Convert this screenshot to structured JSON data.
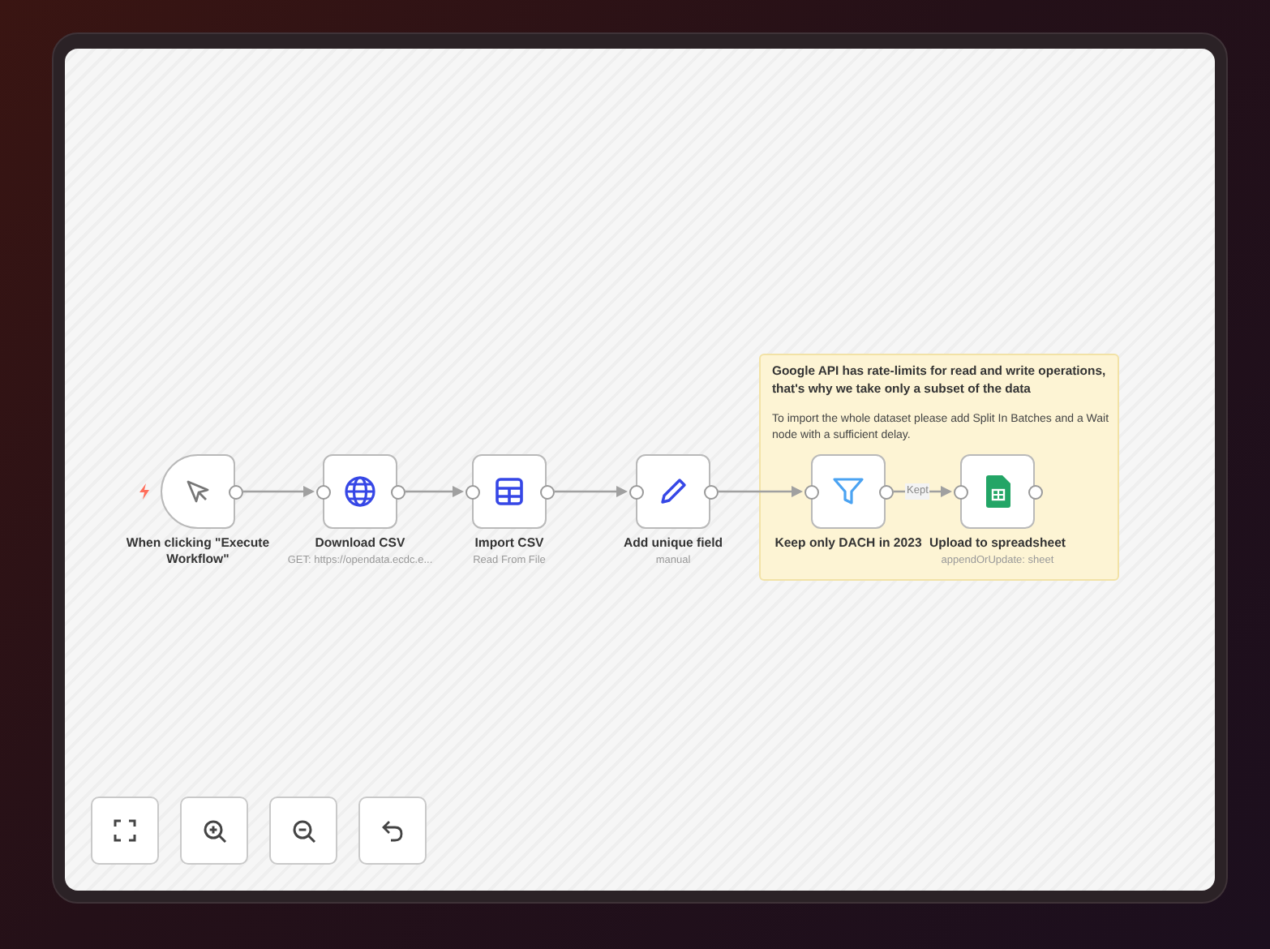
{
  "nodes": [
    {
      "kind": "trigger",
      "name": "When clicking \"Execute Workflow\""
    },
    {
      "kind": "http",
      "name": "Download CSV",
      "subtitle": "GET: https://opendata.ecdc.e..."
    },
    {
      "kind": "table",
      "name": "Import CSV",
      "subtitle": "Read From File"
    },
    {
      "kind": "edit",
      "name": "Add unique field",
      "subtitle": "manual"
    },
    {
      "kind": "filter",
      "name": "Keep only DACH in 2023",
      "output_label": "Kept"
    },
    {
      "kind": "sheets",
      "name": "Upload to spreadsheet",
      "subtitle": "appendOrUpdate: sheet"
    }
  ],
  "sticky_note": {
    "title": "Google API has rate-limits for read and write operations, that's why we take only a subset of the data",
    "body": "To import the whole dataset please add Split In Batches and a Wait node with a sufficient delay."
  },
  "controls": [
    {
      "kind": "fit"
    },
    {
      "kind": "zoom-in"
    },
    {
      "kind": "zoom-out"
    },
    {
      "kind": "undo"
    }
  ]
}
